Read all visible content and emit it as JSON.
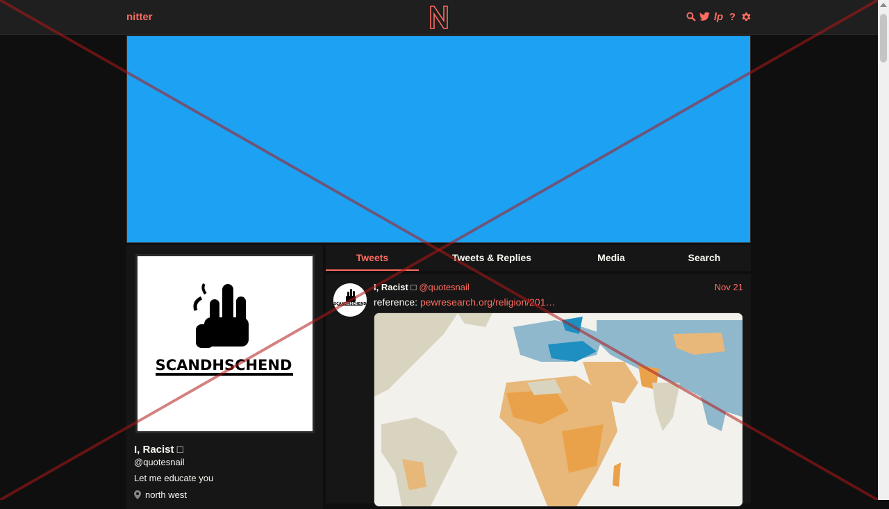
{
  "header": {
    "brand": "nitter",
    "logo_icon": "nitter-logo-icon",
    "icons": [
      "search-icon",
      "twitter-bird-icon",
      "lp-icon",
      "help-icon",
      "gear-icon"
    ],
    "lp_text": "lp",
    "help_text": "?"
  },
  "banner": {
    "color": "#1da1f2"
  },
  "profile": {
    "avatar_text": "SCANDHSCHEND",
    "name": "I, Racist □",
    "handle": "@quotesnail",
    "bio": "Let me educate you",
    "location": "north west"
  },
  "tabs": [
    {
      "label": "Tweets",
      "active": true
    },
    {
      "label": "Tweets & Replies",
      "active": false
    },
    {
      "label": "Media",
      "active": false
    },
    {
      "label": "Search",
      "active": false
    }
  ],
  "tweet": {
    "name": "I, Racist □",
    "handle": "@quotesnail",
    "date": "Nov 21",
    "text_prefix": "reference: ",
    "link": "pewresearch.org/religion/201…"
  },
  "colors": {
    "accent": "#ff6c60",
    "background": "#0f0f0f",
    "panel": "#161616",
    "topbar": "#1f1f1f"
  }
}
